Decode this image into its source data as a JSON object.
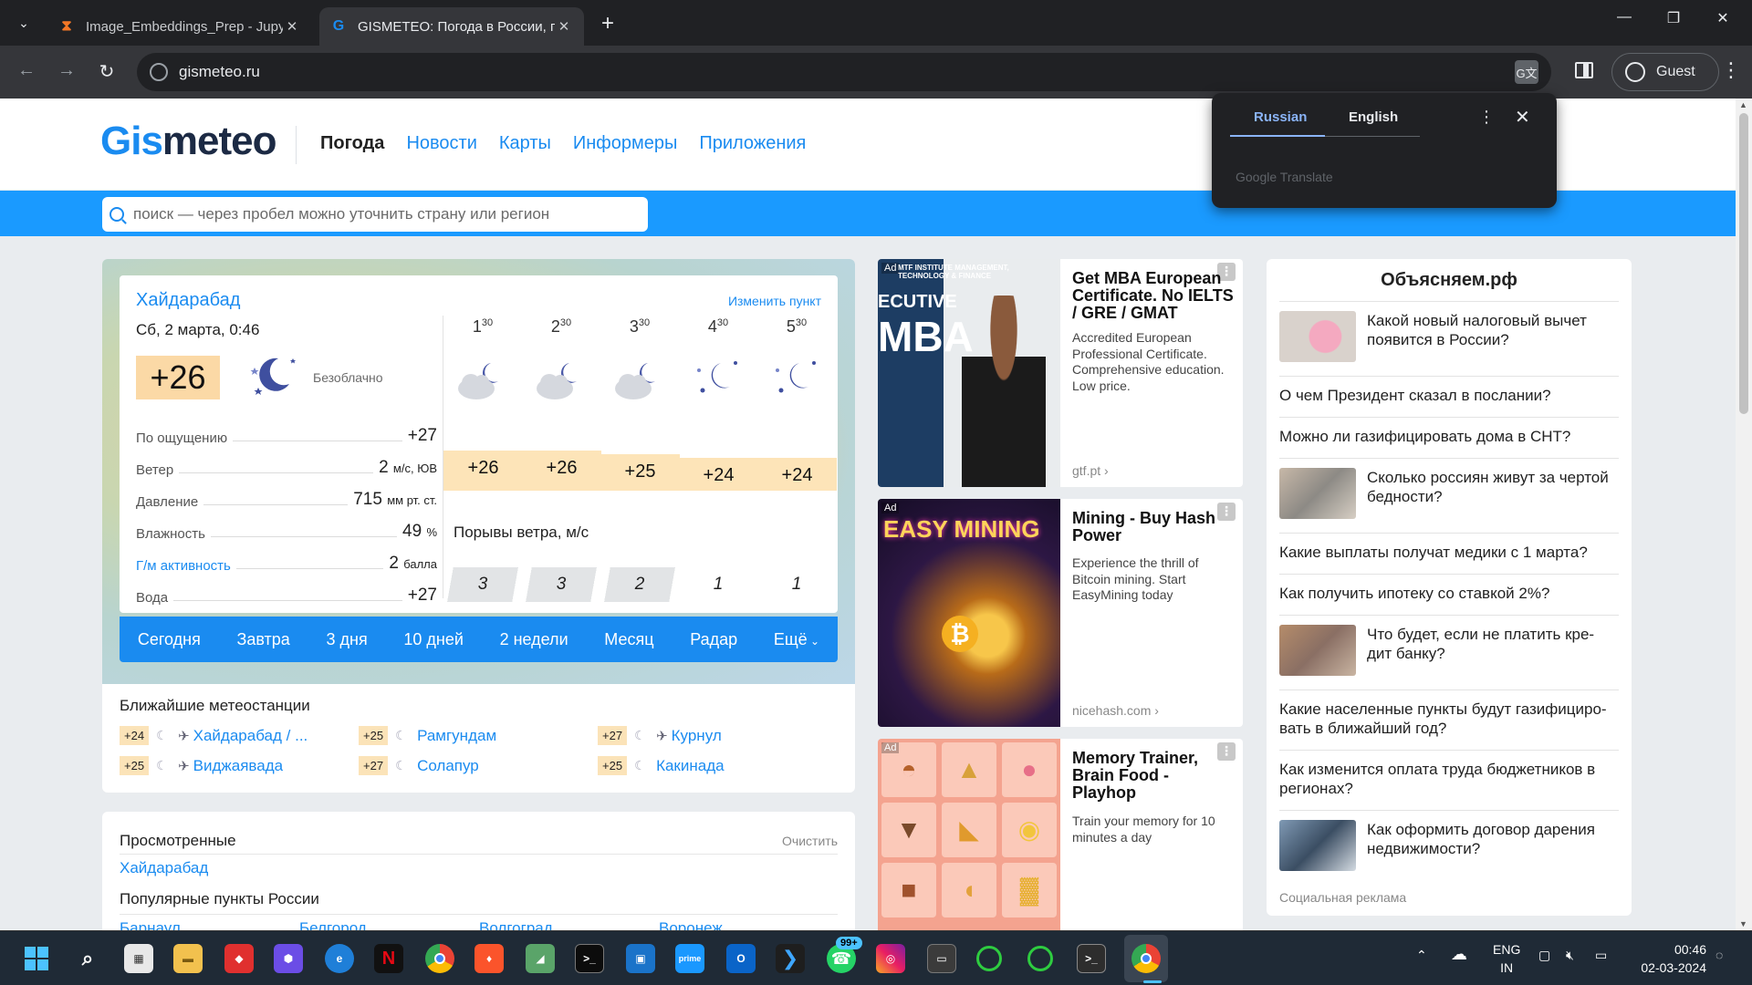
{
  "browser": {
    "tabs": [
      {
        "title": "Image_Embeddings_Prep - Jupy",
        "favicon": "jupyter-icon",
        "active": false
      },
      {
        "title": "GISMETEO: Погода в России, п",
        "favicon": "gismeteo-icon",
        "active": true
      }
    ],
    "url": "gismeteo.ru",
    "profile_label": "Guest"
  },
  "translate_popup": {
    "lang_from": "Russian",
    "lang_to": "English",
    "provider": "Google Translate"
  },
  "header": {
    "logo_part1": "Gis",
    "logo_part2": "meteo",
    "nav": [
      "Погода",
      "Новости",
      "Карты",
      "Информеры",
      "Приложения"
    ],
    "search_placeholder": "поиск — через пробел можно уточнить страну или регион"
  },
  "weather": {
    "city": "Хайдарабад",
    "change_point": "Изменить пункт",
    "date": "Сб, 2 марта, 0:46",
    "temp": "+26",
    "condition": "Безоблачно",
    "params": [
      {
        "label": "По ощущению",
        "value": "+27",
        "unit": ""
      },
      {
        "label": "Ветер",
        "value": "2",
        "unit": "м/с, ЮВ"
      },
      {
        "label": "Давление",
        "value": "715",
        "unit": "мм рт. ст."
      },
      {
        "label": "Влажность",
        "value": "49",
        "unit": "%"
      },
      {
        "label": "Г/м активность",
        "value": "2",
        "unit": "балла"
      },
      {
        "label": "Вода",
        "value": "+27",
        "unit": ""
      }
    ],
    "hours": [
      {
        "h": "1",
        "m": "30",
        "icon": "cloudy-moon-icon",
        "temp": "+26",
        "gust": "3"
      },
      {
        "h": "2",
        "m": "30",
        "icon": "cloudy-moon-icon",
        "temp": "+26",
        "gust": "3"
      },
      {
        "h": "3",
        "m": "30",
        "icon": "cloudy-moon-icon",
        "temp": "+25",
        "gust": "2"
      },
      {
        "h": "4",
        "m": "30",
        "icon": "clear-moon-icon",
        "temp": "+24",
        "gust": "1"
      },
      {
        "h": "5",
        "m": "30",
        "icon": "clear-moon-icon",
        "temp": "+24",
        "gust": "1"
      }
    ],
    "gust_title": "Порывы ветра, м/с",
    "tabs": [
      "Сегодня",
      "Завтра",
      "3 дня",
      "10 дней",
      "2 недели",
      "Месяц",
      "Радар",
      "Ещё"
    ]
  },
  "stations": {
    "title": "Ближайшие метеостанции",
    "items": [
      {
        "temp": "+24",
        "name": "Хайдарабад / ..."
      },
      {
        "temp": "+25",
        "name": "Рамгундам"
      },
      {
        "temp": "+27",
        "name": "Курнул"
      },
      {
        "temp": "+25",
        "name": "Виджаявада"
      },
      {
        "temp": "+27",
        "name": "Солапур"
      },
      {
        "temp": "+25",
        "name": "Какинада"
      }
    ]
  },
  "viewed": {
    "title": "Просмотренные",
    "clear": "Очистить",
    "city": "Хайдарабад",
    "popular_title": "Популярные пункты России",
    "popular": [
      "Барнаул",
      "Белгород",
      "Волгоград",
      "Воронеж"
    ]
  },
  "ads": [
    {
      "tag": "Ad",
      "headline": "Get MBA European Certificate. No IELTS / GRE / GMAT",
      "desc": "Accredited European Professional Certificate. Comprehensive education. Low price.",
      "source": "gtf.pt",
      "img_caption": "MTF INSTITUTE MANAGEMENT, TECHNOLOGY & FINANCE",
      "img_big": "MBA",
      "img_small": "ECUTIVE"
    },
    {
      "tag": "Ad",
      "headline": "Mining - Buy Hash Power",
      "desc": "Experience the thrill of Bitcoin mining. Start EasyMining today",
      "source": "nicehash.com",
      "img_big": "EASY MINING"
    },
    {
      "tag": "Ad",
      "headline": "Memory Trainer, Brain Food - Playhop",
      "desc": "Train your memory for 10 minutes a day",
      "source": ""
    }
  ],
  "news": {
    "title": "Объясняем.рф",
    "items": [
      {
        "text": "Какой новый налоговый вычет появится в России?",
        "thumb": true
      },
      {
        "text": "О чем Президент сказал в послании?",
        "thumb": false
      },
      {
        "text": "Можно ли газифицировать дома в СНТ?",
        "thumb": false
      },
      {
        "text": "Сколько россиян живут за чертой бедности?",
        "thumb": true
      },
      {
        "text": "Какие выплаты получат медики с 1 марта?",
        "thumb": false
      },
      {
        "text": "Как получить ипотеку со ставкой 2%?",
        "thumb": false
      },
      {
        "text": "Что будет, если не платить кре- дит банку?",
        "thumb": true
      },
      {
        "text": "Какие населенные пункты будут газифициро- вать в ближайший год?",
        "thumb": false
      },
      {
        "text": "Как изменится оплата труда бюджетников в регионах?",
        "thumb": false
      },
      {
        "text": "Как оформить договор дарения недвижимости?",
        "thumb": true
      }
    ],
    "footer": "Социальная реклама"
  },
  "taskbar": {
    "whatsapp_badge": "99+",
    "lang_line1": "ENG",
    "lang_line2": "IN",
    "time": "00:46",
    "date": "02-03-2024"
  }
}
